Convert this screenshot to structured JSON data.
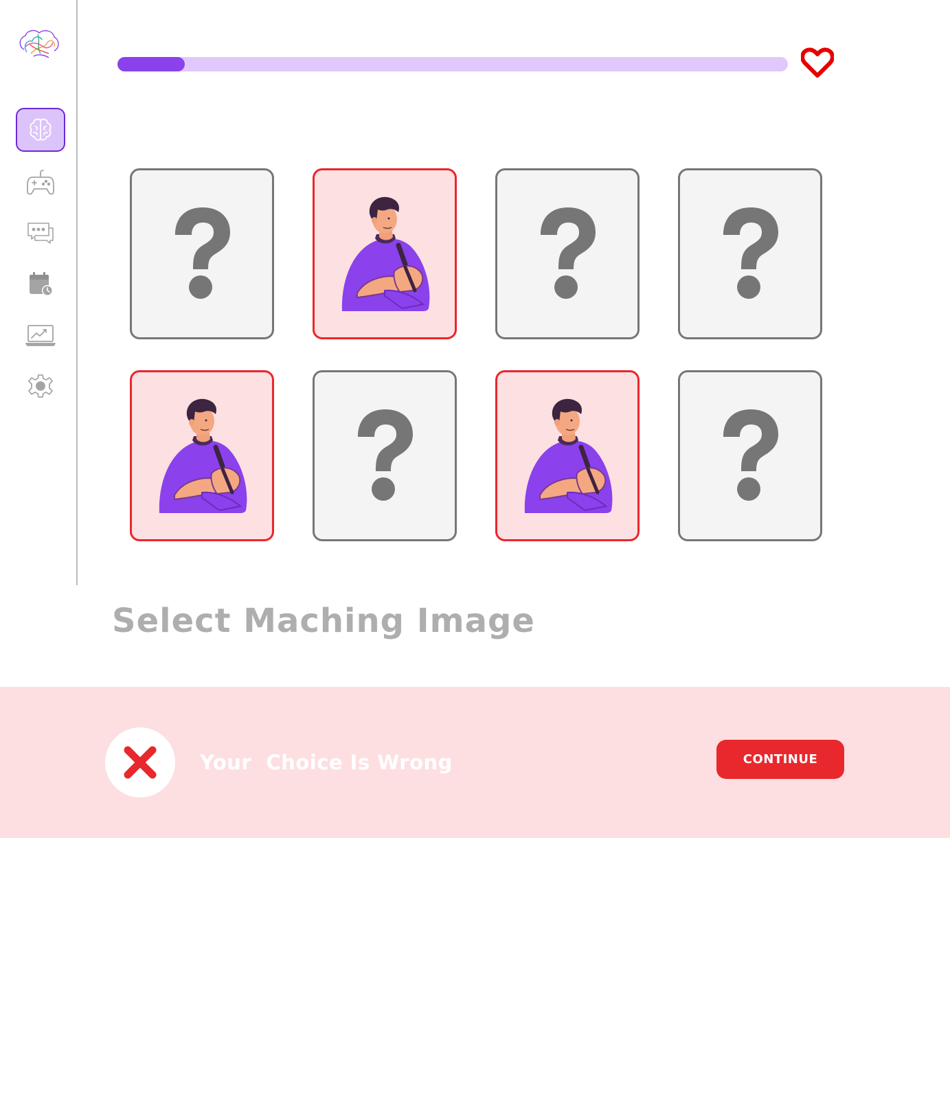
{
  "app": {
    "logo_icon": "brain-logo-icon"
  },
  "sidebar": {
    "items": [
      {
        "id": "brain",
        "icon": "brain-icon",
        "active": true
      },
      {
        "id": "games",
        "icon": "gamepad-icon",
        "active": false
      },
      {
        "id": "chat",
        "icon": "chat-bubbles-icon",
        "active": false
      },
      {
        "id": "schedule",
        "icon": "calendar-clock-icon",
        "active": false
      },
      {
        "id": "progress",
        "icon": "laptop-chart-icon",
        "active": false
      },
      {
        "id": "settings",
        "icon": "gear-icon",
        "active": false
      }
    ]
  },
  "progress": {
    "fraction": 0.1,
    "lives_icon": "heart-icon"
  },
  "game": {
    "cards": [
      {
        "state": "hidden",
        "icon": "question-mark-icon"
      },
      {
        "state": "revealed",
        "icon": "man-illustration-icon"
      },
      {
        "state": "hidden",
        "icon": "question-mark-icon"
      },
      {
        "state": "hidden",
        "icon": "question-mark-icon"
      },
      {
        "state": "revealed",
        "icon": "man-illustration-icon"
      },
      {
        "state": "hidden",
        "icon": "question-mark-icon"
      },
      {
        "state": "revealed",
        "icon": "man-illustration-icon"
      },
      {
        "state": "hidden",
        "icon": "question-mark-icon"
      }
    ],
    "prompt": "Select Maching Image"
  },
  "feedback": {
    "icon": "close-x-icon",
    "message": "Your  Choice Is Wrong",
    "continue_label": "CONTINUE"
  },
  "colors": {
    "accent": "#8b41eb",
    "accent_light": "#e0c8fd",
    "error": "#e8282c",
    "error_bg": "#fddfe1",
    "prompt_text": "#aeaeae",
    "card_border": "#767676"
  }
}
